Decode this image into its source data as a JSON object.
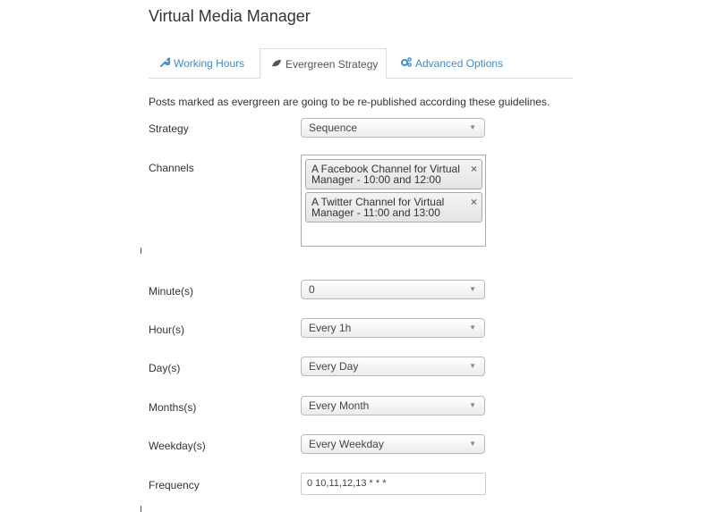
{
  "header": {
    "title": "Virtual Media Manager"
  },
  "tabs": [
    {
      "label": "Working Hours",
      "icon": "wrench-icon",
      "active": false
    },
    {
      "label": "Evergreen Strategy",
      "icon": "leaf-icon",
      "active": true
    },
    {
      "label": "Advanced Options",
      "icon": "cogs-icon",
      "active": false
    }
  ],
  "intro_text": "Posts marked as evergreen are going to be re-published according these guidelines.",
  "form": {
    "strategy": {
      "label": "Strategy",
      "value": "Sequence"
    },
    "channels": {
      "label": "Channels",
      "selected": [
        {
          "text": "A Facebook Channel for Virtual Manager - 10:00 and 12:00",
          "remove": "×"
        },
        {
          "text": "A Twitter Channel for Virtual Manager - 11:00 and 13:00",
          "remove": "×"
        }
      ]
    },
    "minutes": {
      "label": "Minute(s)",
      "value": "0"
    },
    "hours": {
      "label": "Hour(s)",
      "value": "Every 1h"
    },
    "days": {
      "label": "Day(s)",
      "value": "Every Day"
    },
    "months": {
      "label": "Months(s)",
      "value": "Every Month"
    },
    "weekdays": {
      "label": "Weekday(s)",
      "value": "Every Weekday"
    },
    "frequency": {
      "label": "Frequency",
      "value": "0 10,11,12,13 * * *"
    }
  },
  "caret": "▼",
  "colors": {
    "link": "#428bca",
    "text": "#333333",
    "border": "#dddddd"
  }
}
